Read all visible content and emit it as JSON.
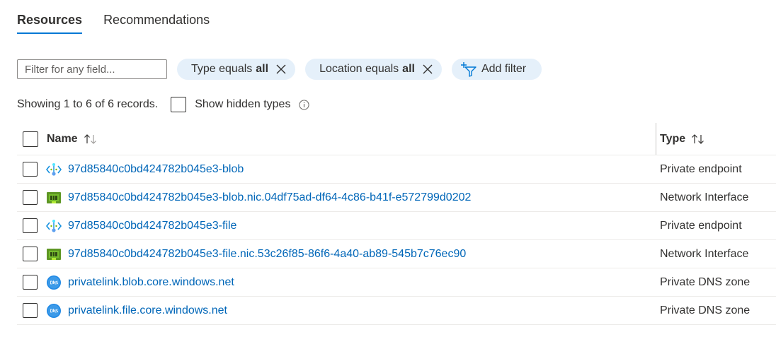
{
  "tabs": [
    {
      "label": "Resources",
      "active": true
    },
    {
      "label": "Recommendations",
      "active": false
    }
  ],
  "filter": {
    "placeholder": "Filter for any field...",
    "pills": [
      {
        "prefix": "Type equals",
        "value": "all"
      },
      {
        "prefix": "Location equals",
        "value": "all"
      }
    ],
    "add_filter_label": "Add filter"
  },
  "status": {
    "records_text": "Showing 1 to 6 of 6 records.",
    "show_hidden_label": "Show hidden types"
  },
  "table": {
    "columns": {
      "name": "Name",
      "type": "Type"
    },
    "rows": [
      {
        "name": "97d85840c0bd424782b045e3-blob",
        "type": "Private endpoint",
        "icon": "private-endpoint-icon"
      },
      {
        "name": "97d85840c0bd424782b045e3-blob.nic.04df75ad-df64-4c86-b41f-e572799d0202",
        "type": "Network Interface",
        "icon": "network-interface-icon"
      },
      {
        "name": "97d85840c0bd424782b045e3-file",
        "type": "Private endpoint",
        "icon": "private-endpoint-icon"
      },
      {
        "name": "97d85840c0bd424782b045e3-file.nic.53c26f85-86f6-4a40-ab89-545b7c76ec90",
        "type": "Network Interface",
        "icon": "network-interface-icon"
      },
      {
        "name": "privatelink.blob.core.windows.net",
        "type": "Private DNS zone",
        "icon": "dns-zone-icon"
      },
      {
        "name": "privatelink.file.core.windows.net",
        "type": "Private DNS zone",
        "icon": "dns-zone-icon"
      }
    ]
  },
  "colors": {
    "accent": "#0078d4",
    "link": "#0066b8",
    "pill_bg": "#e5f0fa"
  }
}
